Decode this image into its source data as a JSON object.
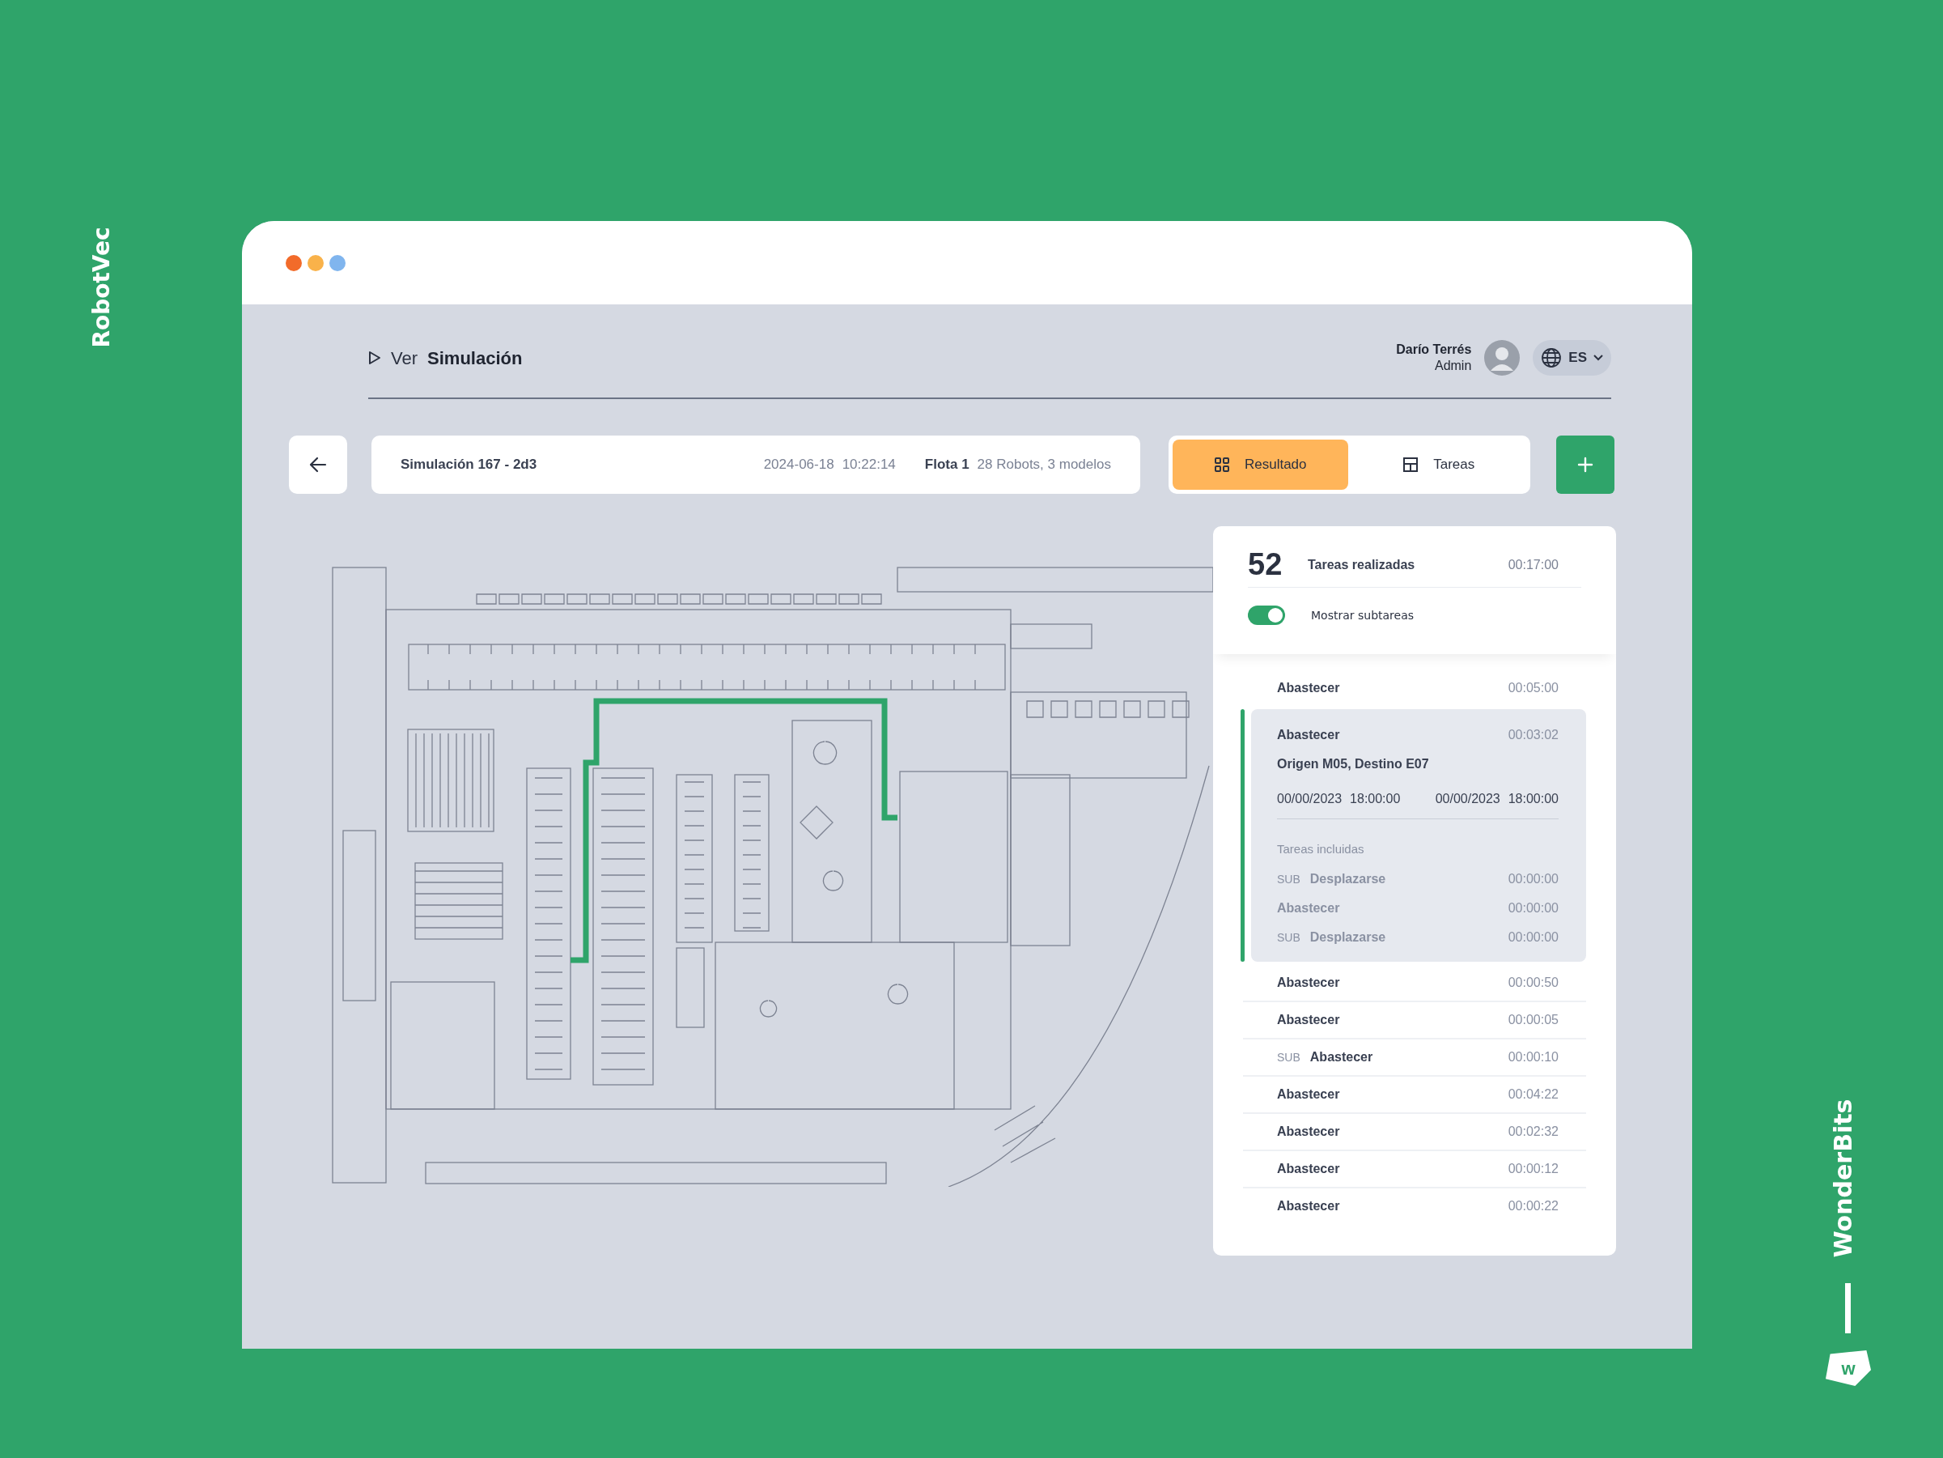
{
  "brand": {
    "left": "RobotVec",
    "right": "WonderBits",
    "logo": "w"
  },
  "window": {
    "dots": [
      {
        "color": "#f26b2a"
      },
      {
        "color": "#f9b24a"
      },
      {
        "color": "#80b5ee"
      }
    ]
  },
  "header": {
    "prefix": "Ver",
    "title": "Simulación"
  },
  "user": {
    "name": "Darío Terrés",
    "role": "Admin",
    "language": "ES"
  },
  "simulation": {
    "name": "Simulación 167 - 2d3",
    "date": "2024-06-18",
    "time": "10:22:14",
    "fleet_label": "Flota 1",
    "fleet_detail": "28 Robots, 3 modelos"
  },
  "tabs": [
    {
      "label": "Resultado",
      "selected": true
    },
    {
      "label": "Tareas",
      "selected": false
    }
  ],
  "summary": {
    "count": "52",
    "label": "Tareas realizadas",
    "duration": "00:17:00"
  },
  "subtask_toggle": {
    "label": "Mostrar subtareas",
    "on": true
  },
  "tasks": [
    {
      "name": "Abastecer",
      "duration": "00:05:00",
      "expanded": false
    },
    {
      "name": "Abastecer",
      "duration": "00:03:02",
      "expanded": true,
      "detail": {
        "route": "Origen M05, Destino E07",
        "start_date": "00/00/2023",
        "start_time": "18:00:00",
        "end_date": "00/00/2023",
        "end_time": "18:00:00",
        "included_label": "Tareas incluidas",
        "subtasks": [
          {
            "prefix": "SUB",
            "name": "Desplazarse",
            "duration": "00:00:00"
          },
          {
            "name": "Abastecer",
            "duration": "00:00:00"
          },
          {
            "prefix": "SUB",
            "name": "Desplazarse",
            "duration": "00:00:00"
          }
        ]
      }
    },
    {
      "name": "Abastecer",
      "duration": "00:00:50",
      "expanded": false
    },
    {
      "name": "Abastecer",
      "duration": "00:00:05",
      "expanded": false
    },
    {
      "prefix": "SUB",
      "name": "Abastecer",
      "duration": "00:00:10",
      "expanded": false
    },
    {
      "name": "Abastecer",
      "duration": "00:04:22",
      "expanded": false
    },
    {
      "name": "Abastecer",
      "duration": "00:02:32",
      "expanded": false
    },
    {
      "name": "Abastecer",
      "duration": "00:00:12",
      "expanded": false
    },
    {
      "name": "Abastecer",
      "duration": "00:00:22",
      "expanded": false
    }
  ]
}
